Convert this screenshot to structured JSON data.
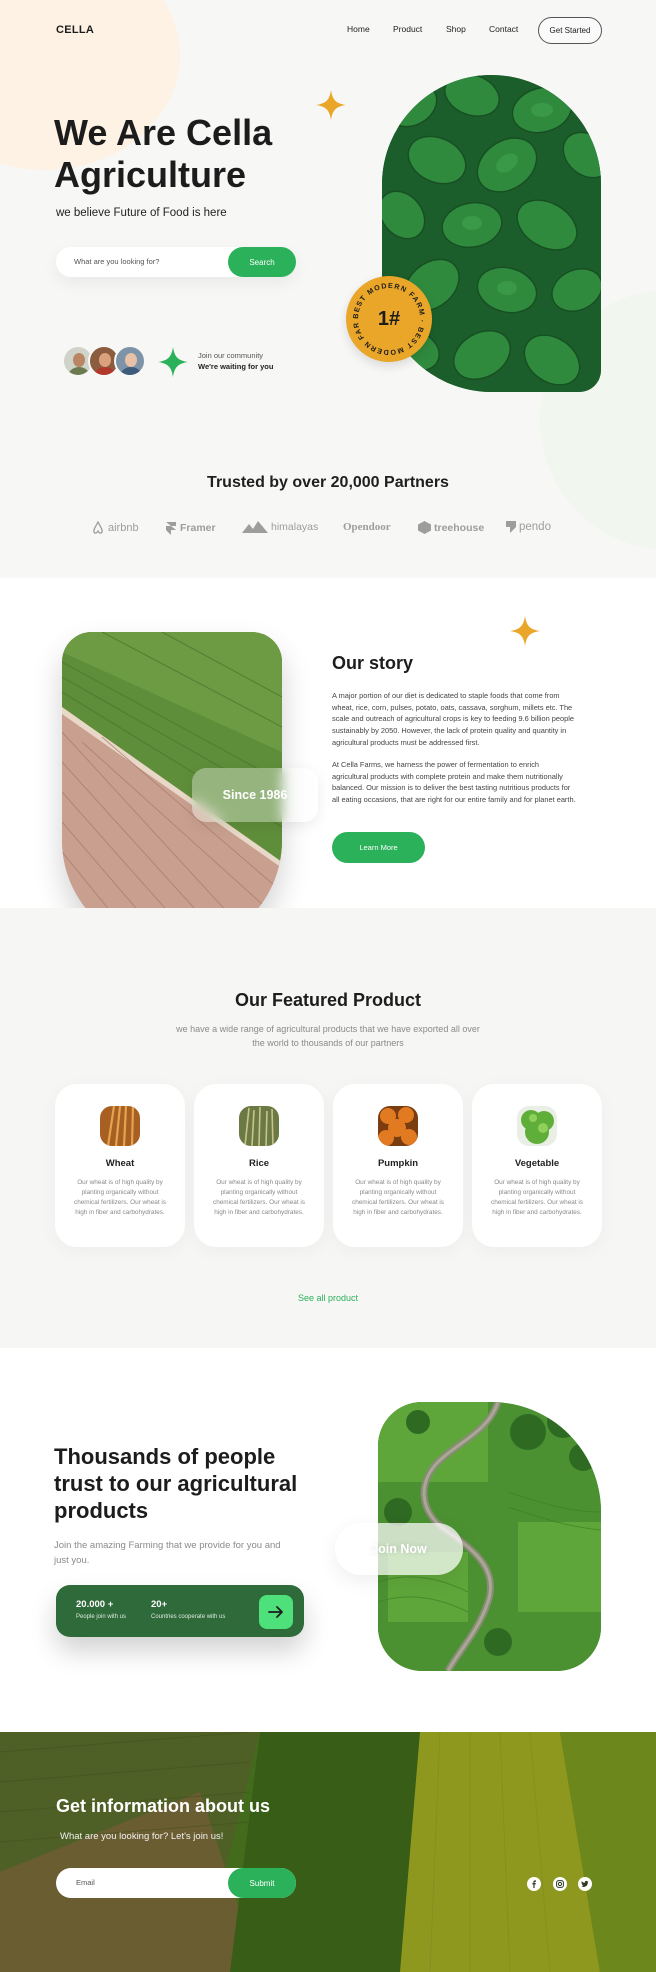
{
  "header": {
    "logo": "CELLA",
    "nav": [
      "Home",
      "Product",
      "Shop",
      "Contact"
    ],
    "cta": "Get Started"
  },
  "hero": {
    "title_line1": "We Are Cella",
    "title_line2": "Agriculture",
    "subtitle": "we believe Future of Food is here",
    "search_placeholder": "What are you looking for?",
    "search_button": "Search",
    "community_line1": "Join our community",
    "community_line2": "We're waiting for you",
    "badge_number": "1#",
    "badge_ring_text": "BEST MODERN FARM · BEST MODERN FARM ·"
  },
  "partners": {
    "heading": "Trusted by over 20,000 Partners",
    "logos": [
      "airbnb",
      "Framer",
      "himalayas",
      "Opendoor",
      "treehouse",
      "pendo"
    ]
  },
  "story": {
    "title": "Our story",
    "since": "Since 1986",
    "paragraph1": "A major portion of our diet is dedicated to staple foods that come from wheat, rice, corn, pulses, potato, oats, cassava, sorghum, millets etc. The scale and outreach of agricultural crops is key to feeding 9.6 billion people sustainably by 2050. However, the lack of protein quality and quantity in agricultural products must be addressed first.",
    "paragraph2": "At Cella Farms, we harness the power of fermentation to enrich agricultural products with complete protein and make them nutritionally balanced. Our mission is to deliver the best tasting nutritious products for all eating occasions, that are right for our entire family and for planet earth.",
    "button": "Learn More"
  },
  "featured": {
    "title": "Our Featured Product",
    "subtitle": "we have a wide range of agricultural products that we have exported all over the world to thousands of our partners",
    "products": [
      {
        "name": "Wheat",
        "desc": "Our wheat is of high quality by planting organically without chemical fertilizers. Our wheat is high in fiber and carbohydrates."
      },
      {
        "name": "Rice",
        "desc": "Our wheat is of high quality by planting organically without chemical fertilizers. Our wheat is high in fiber and carbohydrates."
      },
      {
        "name": "Pumpkin",
        "desc": "Our wheat is of high quality by planting organically without chemical fertilizers. Our wheat is high in fiber and carbohydrates."
      },
      {
        "name": "Vegetable",
        "desc": "Our wheat is of high quality by planting organically without chemical fertilizers. Our wheat is high in fiber and carbohydrates."
      }
    ],
    "see_all": "See all product"
  },
  "join": {
    "title_line1": "Thousands of people",
    "title_line2": "trust to our agricultural",
    "title_line3": "products",
    "subtitle": "Join the amazing Farming that we provide for you and just you.",
    "stat1_value": "20.000 +",
    "stat1_label": "People join with us",
    "stat2_value": "20+",
    "stat2_label": "Countries cooperate with us",
    "join_button": "Join Now"
  },
  "footer": {
    "title": "Get information about us",
    "subtitle": "What are you looking for? Let's join us!",
    "email_placeholder": "Email",
    "submit": "Submit",
    "social": [
      "facebook-icon",
      "instagram-icon",
      "twitter-icon"
    ]
  },
  "colors": {
    "accent_green": "#2bb15a",
    "accent_gold": "#e9a628",
    "dark_green": "#2f6a3b"
  }
}
